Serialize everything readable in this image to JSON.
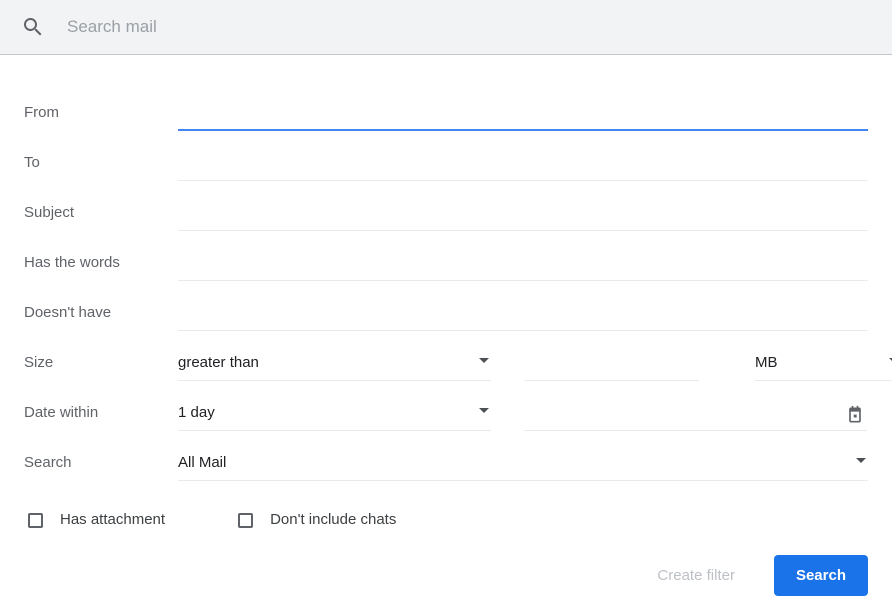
{
  "search_bar": {
    "icon": "search-icon",
    "placeholder": "Search mail",
    "value": ""
  },
  "form": {
    "rows": [
      {
        "label": "From",
        "value": "",
        "focused": true
      },
      {
        "label": "To",
        "value": "",
        "focused": false
      },
      {
        "label": "Subject",
        "value": "",
        "focused": false
      },
      {
        "label": "Has the words",
        "value": "",
        "focused": false
      },
      {
        "label": "Doesn't have",
        "value": "",
        "focused": false
      }
    ],
    "size": {
      "label": "Size",
      "operator": "greater than",
      "amount": "",
      "unit": "MB"
    },
    "date_within": {
      "label": "Date within",
      "range": "1 day",
      "date": "",
      "calendar_icon": "calendar-icon"
    },
    "scope": {
      "label": "Search",
      "value": "All Mail"
    },
    "checkboxes": [
      {
        "label": "Has attachment",
        "checked": false
      },
      {
        "label": "Don't include chats",
        "checked": false
      }
    ]
  },
  "actions": {
    "create_filter_label": "Create filter",
    "search_label": "Search"
  },
  "colors": {
    "accent_blue": "#1a73e8",
    "focus_underline": "#4285f4",
    "label_gray": "#5f6368",
    "underline_gray": "#e9eaec",
    "searchbar_bg": "#f1f3f4",
    "disabled_text": "#bdc1c6"
  }
}
